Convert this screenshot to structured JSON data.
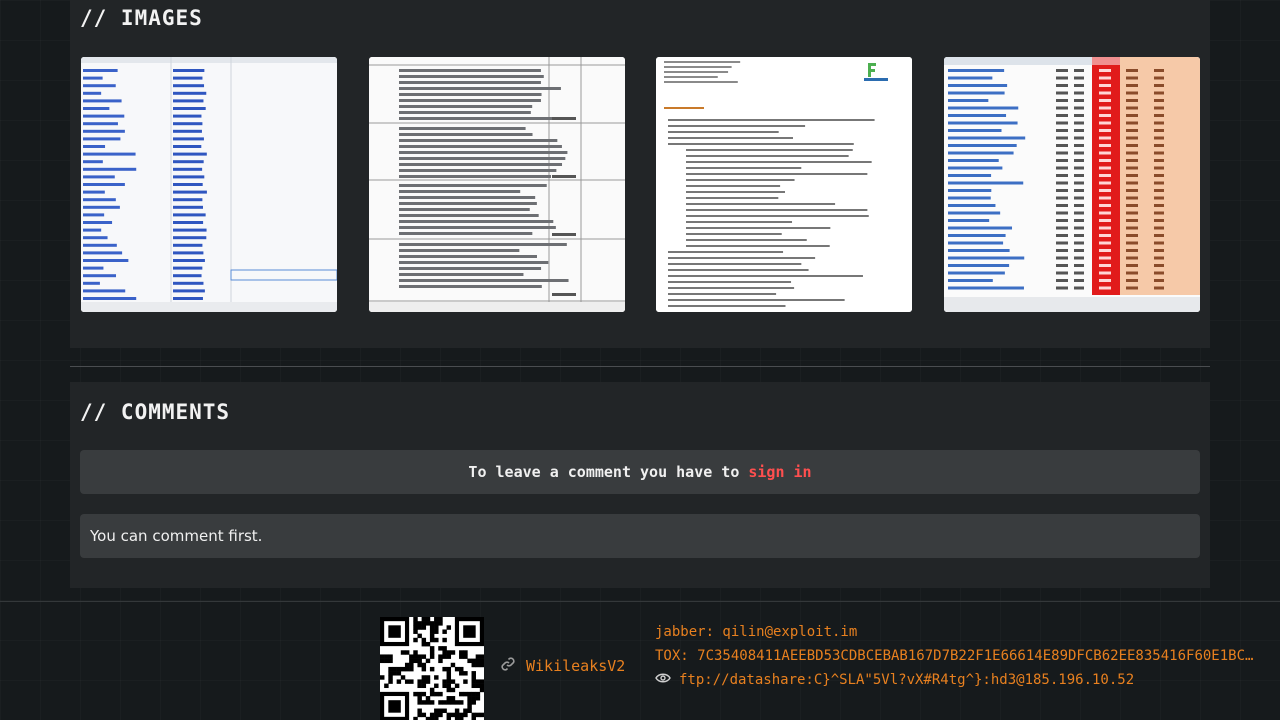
{
  "images_section": {
    "title": "// IMAGES",
    "thumbnails": [
      {
        "name": "spreadsheet-preview"
      },
      {
        "name": "invoice-lines-preview"
      },
      {
        "name": "faycom-letter-preview"
      },
      {
        "name": "price-table-preview"
      }
    ]
  },
  "comments_section": {
    "title": "// COMMENTS",
    "signin_prefix": "To leave a comment you have to",
    "signin_link": "sign in",
    "empty_message": "You can comment first."
  },
  "footer": {
    "site_label": "WikileaksV2",
    "jabber": "jabber: qilin@exploit.im",
    "tox": "TOX: 7C35408411AEEBD53CDBCEBAB167D7B22F1E66614E89DFCB62EE835416F60E1BC…",
    "ftp": "ftp://datashare:C}^SLA\"5Vl?vX#R4tg^}:hd3@185.196.10.52",
    "icons": {
      "link": "link-icon",
      "eye": "eye-icon"
    },
    "accent_color": "#e8801f"
  },
  "colors": {
    "signin_link": "#ff4f4f",
    "panel": "#222527",
    "box": "#393c3e"
  }
}
